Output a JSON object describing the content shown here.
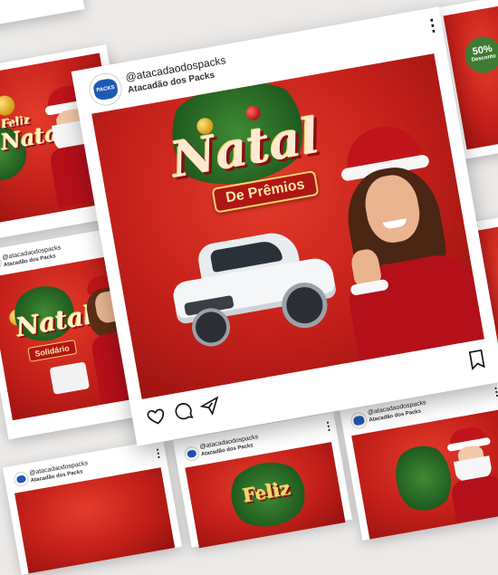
{
  "main_post": {
    "handle": "@atacadaodospacks",
    "brand": "Atacadão dos Packs",
    "avatar_label": "PACKS",
    "title_script": "Natal",
    "title_banner": "De Prêmios",
    "more_icon": "more-vertical-icon",
    "actions": [
      "heart-icon",
      "comment-icon",
      "share-icon",
      "bookmark-icon"
    ]
  },
  "left_post": {
    "feliz_text": "Feliz",
    "script_text": "Natal"
  },
  "left_mid_post": {
    "handle": "@atacadaodospacks",
    "brand": "Atacadão dos Packs",
    "title_script": "Natal",
    "title_banner": "Solidário"
  },
  "right_top_post": {
    "discount_text": "50%",
    "discount_sub": "Desconto"
  },
  "bottom_left_post": {
    "handle": "@atacadaodospacks",
    "brand": "Atacadão dos Packs"
  },
  "bottom_mid_post": {
    "handle": "@atacadaodospacks",
    "brand": "Atacadão dos Packs",
    "script_text": "Feliz"
  },
  "bottom_right_post": {
    "handle": "@atacadaodospacks",
    "brand": "Atacadão dos Packs"
  },
  "colors": {
    "brand_red": "#c3201a",
    "brand_blue": "#1f59b5",
    "gold": "#f5d46b"
  }
}
